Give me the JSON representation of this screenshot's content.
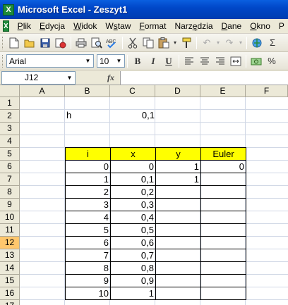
{
  "window": {
    "title": "Microsoft Excel - Zeszyt1",
    "app_icon_glyph": "X"
  },
  "menu": {
    "items": [
      {
        "pre": "",
        "ul": "P",
        "post": "lik"
      },
      {
        "pre": "",
        "ul": "E",
        "post": "dycja"
      },
      {
        "pre": "",
        "ul": "W",
        "post": "idok"
      },
      {
        "pre": "W",
        "ul": "s",
        "post": "taw"
      },
      {
        "pre": "",
        "ul": "F",
        "post": "ormat"
      },
      {
        "pre": "Narz",
        "ul": "ę",
        "post": "dzia"
      },
      {
        "pre": "",
        "ul": "D",
        "post": "ane"
      },
      {
        "pre": "",
        "ul": "O",
        "post": "kno"
      },
      {
        "pre": "P",
        "ul": "",
        "post": ""
      }
    ]
  },
  "format_toolbar": {
    "font_name": "Arial",
    "font_size": "10",
    "bold": "B",
    "italic": "I",
    "underline": "U"
  },
  "toolbar_icons": [
    "new-icon",
    "open-icon",
    "save-icon",
    "permission-icon",
    "print-icon",
    "print-preview-icon",
    "spelling-icon",
    "cut-icon",
    "copy-icon",
    "paste-icon",
    "format-painter-icon",
    "undo-icon",
    "redo-icon",
    "hyperlink-icon",
    "autosum-icon"
  ],
  "formula_bar": {
    "name_box": "J12",
    "fx": "fx",
    "content": ""
  },
  "columns": [
    "A",
    "B",
    "C",
    "D",
    "E",
    "F"
  ],
  "rows": [
    "1",
    "2",
    "3",
    "4",
    "5",
    "6",
    "7",
    "8",
    "9",
    "10",
    "11",
    "12",
    "13",
    "14",
    "15",
    "16",
    "17"
  ],
  "active_row": "12",
  "sheet": {
    "h_label": "h",
    "h_value": "0,1",
    "headers": [
      "i",
      "x",
      "y",
      "Euler"
    ],
    "i_values": [
      "0",
      "1",
      "2",
      "3",
      "4",
      "5",
      "6",
      "7",
      "8",
      "9",
      "10"
    ],
    "x_values": [
      "0",
      "0,1",
      "0,2",
      "0,3",
      "0,4",
      "0,5",
      "0,6",
      "0,7",
      "0,8",
      "0,9",
      "1"
    ],
    "y_values": [
      "1",
      "1"
    ],
    "euler_values": [
      "0"
    ]
  },
  "colors": {
    "header_fill": "#ffff00",
    "active_row_header": "#ffc76d",
    "title_bar": "#0047c8"
  }
}
